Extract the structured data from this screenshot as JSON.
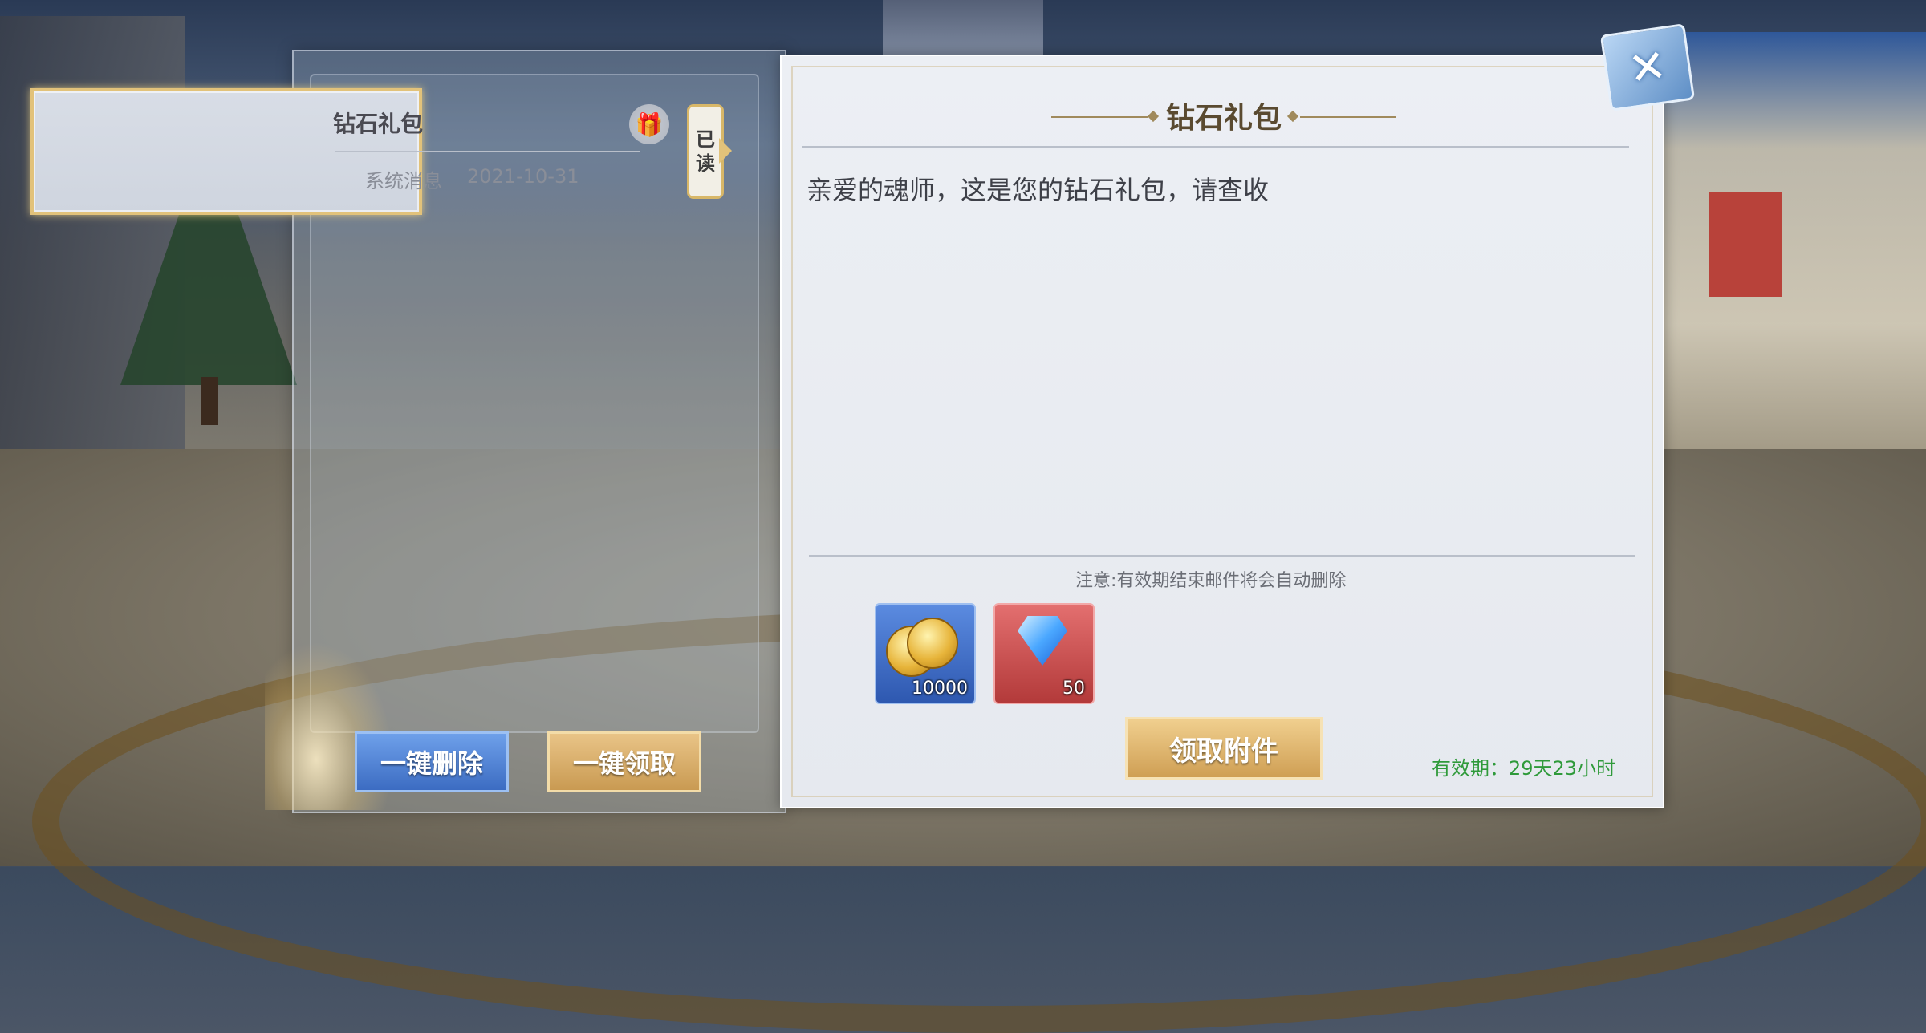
{
  "mail_list": {
    "items": [
      {
        "title": "钻石礼包",
        "sender": "系统消息",
        "date": "2021-10-31",
        "status_line1": "已",
        "status_line2": "读"
      }
    ],
    "buttons": {
      "delete_all": "一键删除",
      "collect_all": "一键领取"
    }
  },
  "mail_detail": {
    "title": "钻石礼包",
    "body": "亲爱的魂师，这是您的钻石礼包，请查收",
    "notice": "注意:有效期结束邮件将会自动删除",
    "attachments": [
      {
        "name": "gold-coin",
        "count": "10000"
      },
      {
        "name": "diamond",
        "count": "50"
      }
    ],
    "claim_label": "领取附件",
    "validity": "有效期：29天23小时"
  },
  "colors": {
    "validity": "#2f9a3a",
    "accent_gold": "#e2c27a",
    "delete_blue": "#3c6cc2"
  }
}
